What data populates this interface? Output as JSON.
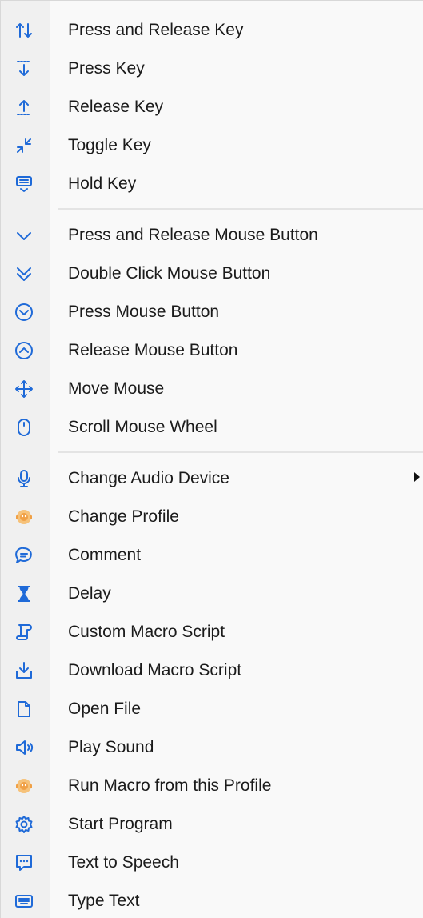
{
  "colors": {
    "icon_blue": "#1f6ad8",
    "icon_orange": "#f0a046",
    "text": "#1b1b1b",
    "background": "#f9f9f9",
    "separator": "#e4e4e4"
  },
  "groups": [
    {
      "name": "keyboard",
      "items": [
        {
          "label": "Press and Release Key",
          "icon": "up-down-arrows-icon"
        },
        {
          "label": "Press Key",
          "icon": "press-key-icon"
        },
        {
          "label": "Release Key",
          "icon": "release-key-icon"
        },
        {
          "label": "Toggle Key",
          "icon": "toggle-key-icon"
        },
        {
          "label": "Hold Key",
          "icon": "hold-key-icon"
        }
      ]
    },
    {
      "name": "mouse",
      "items": [
        {
          "label": "Press and Release Mouse Button",
          "icon": "chevron-down-icon"
        },
        {
          "label": "Double Click Mouse Button",
          "icon": "double-chevron-down-icon"
        },
        {
          "label": "Press Mouse Button",
          "icon": "circle-chevron-down-icon"
        },
        {
          "label": "Release Mouse Button",
          "icon": "circle-chevron-up-icon"
        },
        {
          "label": "Move Mouse",
          "icon": "move-arrows-icon"
        },
        {
          "label": "Scroll Mouse Wheel",
          "icon": "mouse-icon"
        }
      ]
    },
    {
      "name": "other",
      "items": [
        {
          "label": "Change Audio Device",
          "icon": "microphone-icon",
          "submenu": true
        },
        {
          "label": "Change Profile",
          "icon": "profile-face-icon"
        },
        {
          "label": "Comment",
          "icon": "comment-bubble-icon"
        },
        {
          "label": "Delay",
          "icon": "hourglass-icon"
        },
        {
          "label": "Custom Macro Script",
          "icon": "script-icon"
        },
        {
          "label": "Download Macro Script",
          "icon": "download-icon"
        },
        {
          "label": "Open File",
          "icon": "file-icon"
        },
        {
          "label": "Play Sound",
          "icon": "speaker-icon"
        },
        {
          "label": "Run Macro from this Profile",
          "icon": "profile-face-icon"
        },
        {
          "label": "Start Program",
          "icon": "gear-icon"
        },
        {
          "label": "Text to Speech",
          "icon": "speech-bubble-icon"
        },
        {
          "label": "Type Text",
          "icon": "keyboard-icon"
        }
      ]
    }
  ]
}
